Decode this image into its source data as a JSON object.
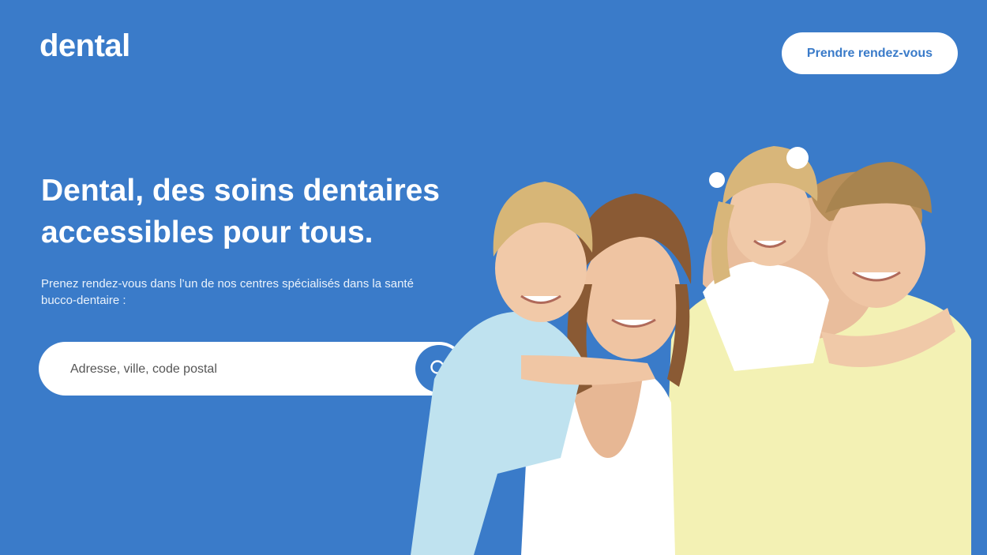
{
  "header": {
    "logo": "dental",
    "cta_label": "Prendre rendez-vous"
  },
  "hero": {
    "title": "Dental, des soins dentaires accessibles pour tous.",
    "subtitle": "Prenez rendez-vous dans l’un de nos centres spécialisés dans la santé bucco-dentaire :"
  },
  "search": {
    "placeholder": "Adresse, ville, code postal",
    "button_icon": "search-icon"
  },
  "image": {
    "subject": "family-photo"
  },
  "colors": {
    "brand": "#3a7bc9",
    "white": "#ffffff"
  }
}
